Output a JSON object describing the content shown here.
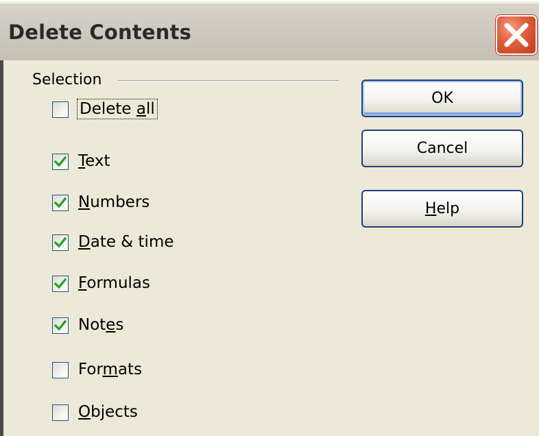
{
  "window": {
    "title": "Delete Contents"
  },
  "selection": {
    "group_label": "Selection",
    "options": [
      {
        "label": "Delete all",
        "mnemonic": "a",
        "checked": false,
        "focused": true
      },
      {
        "label": "Text",
        "mnemonic": "T",
        "checked": true
      },
      {
        "label": "Numbers",
        "mnemonic": "N",
        "checked": true
      },
      {
        "label": "Date & time",
        "mnemonic": "D",
        "checked": true
      },
      {
        "label": "Formulas",
        "mnemonic": "F",
        "checked": true
      },
      {
        "label": "Notes",
        "mnemonic": "e",
        "checked": true
      },
      {
        "label": "Formats",
        "mnemonic": "m",
        "checked": false
      },
      {
        "label": "Objects",
        "mnemonic": "O",
        "checked": false
      }
    ]
  },
  "buttons": {
    "ok": "OK",
    "cancel": "Cancel",
    "help": "Help",
    "help_mnemonic": "H"
  },
  "icons": {
    "close": "close-icon",
    "check": "checkmark-icon"
  },
  "colors": {
    "dialog_bg": "#ece9d8",
    "close_button": "#e0623f",
    "checkmark": "#21a121",
    "button_border": "#1f3f7a"
  }
}
